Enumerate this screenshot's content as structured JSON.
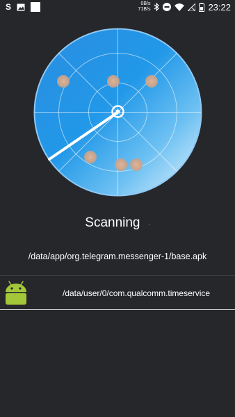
{
  "status_bar": {
    "left_icons": [
      "s-app-icon",
      "image-icon",
      "white-square-icon"
    ],
    "s_label": "S",
    "net_down": "0B/s",
    "net_up": "71B/s",
    "right_icons": [
      "bluetooth-icon",
      "dnd-icon",
      "wifi-icon",
      "no-signal-icon",
      "battery-icon"
    ],
    "time": "23:22"
  },
  "scanner": {
    "status_text": "Scanning",
    "status_dot": ".",
    "current_path": "/data/app/org.telegram.messenger-1/base.apk"
  },
  "results": [
    {
      "icon": "android-icon",
      "path": "/data/user/0/com.qualcomm.timeservice"
    }
  ],
  "colors": {
    "background": "#26272b",
    "radar_blue": "#2196e8",
    "radar_light": "#cfe9fb",
    "radar_rim": "#7fbff0",
    "android_green": "#a4c639"
  }
}
